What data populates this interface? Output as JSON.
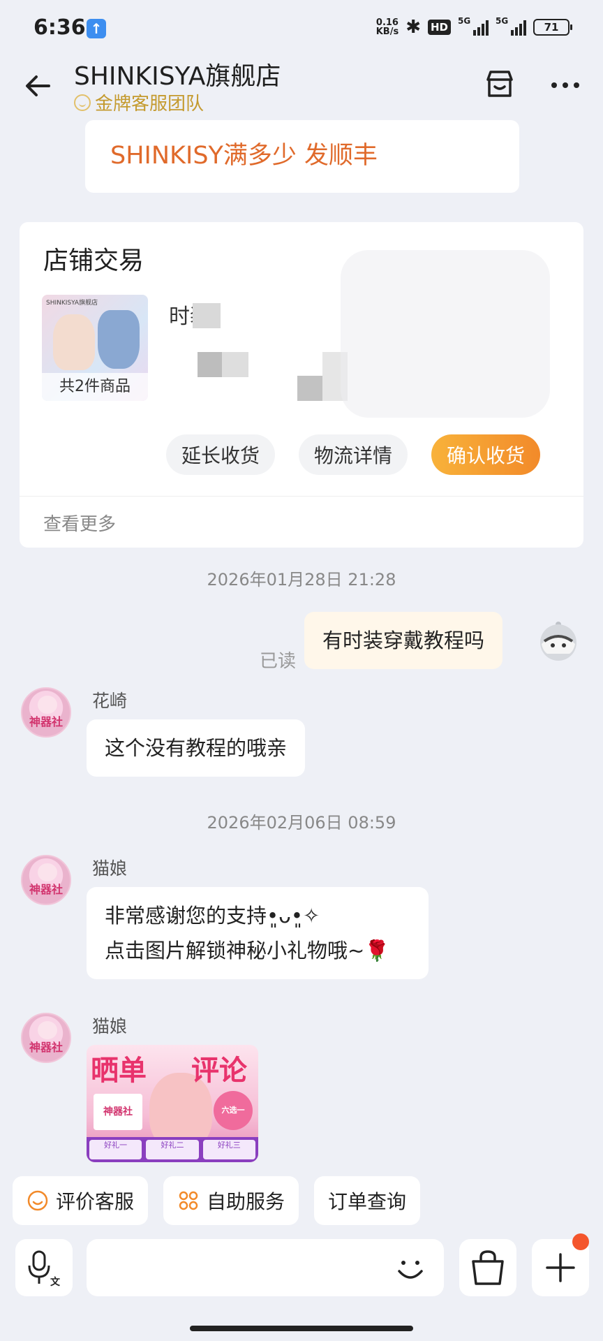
{
  "status_bar": {
    "time": "6:36",
    "net_speed_value": "0.16",
    "net_speed_unit": "KB/s",
    "hd_label": "HD",
    "signal1_label": "5G",
    "signal2_label": "5G",
    "battery": "71"
  },
  "header": {
    "title": "SHINKISYA旗舰店",
    "subtitle": "金牌客服团队"
  },
  "promo_message": "SHINKISY满多少 发顺丰",
  "order_card": {
    "title": "店铺交易",
    "thumb_brand": "SHINKISYA旗舰店",
    "item_count": "共2件商品",
    "item_title": "时装",
    "buttons": {
      "extend": "延长收货",
      "logistics": "物流详情",
      "confirm": "确认收货"
    },
    "view_more": "查看更多"
  },
  "messages": {
    "time1": "2026年01月28日 21:28",
    "out1_text": "有时装穿戴教程吗",
    "out1_status": "已读",
    "in1_sender": "花崎",
    "in1_text": "这个没有教程的哦亲",
    "time2": "2026年02月06日 08:59",
    "in2_sender": "猫娘",
    "in2_line1": "非常感谢您的支持•͈ᴗ•͈✧",
    "in2_line2": "点击图片解锁神秘小礼物哦~🌹",
    "in3_sender": "猫娘",
    "avatar_text": "神器社"
  },
  "promo_image": {
    "title_left": "晒单",
    "title_right": "评论",
    "logo": "神器社",
    "badge": "六选一 FREE",
    "gift1": "好礼一",
    "gift2": "好礼二",
    "gift3": "好礼三"
  },
  "quick_actions": {
    "rate": "评价客服",
    "self_service": "自助服务",
    "order_query": "订单查询"
  },
  "input": {
    "placeholder": ""
  },
  "colors": {
    "accent_orange": "#f28a2a",
    "promo_text": "#e06a2b",
    "gold": "#c49a2e",
    "outgoing_bubble": "#fff7ea",
    "notification_dot": "#f4552c"
  }
}
